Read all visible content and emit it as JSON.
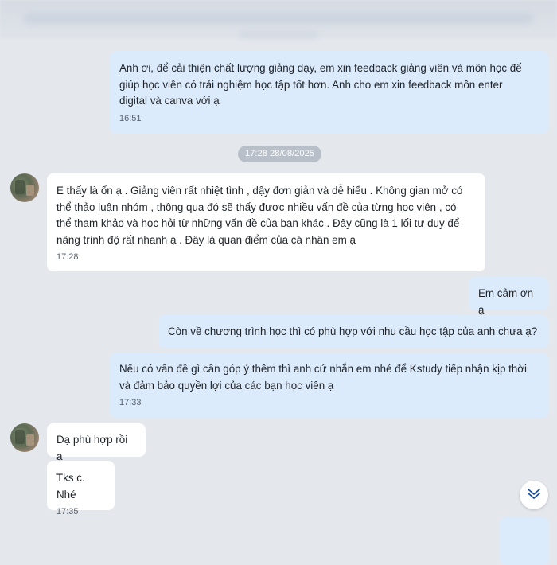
{
  "messages": {
    "m1": {
      "text": "Anh ơi, để cải thiện chất lượng giảng dạy, em xin feedback giảng viên và môn học để\ngiúp học viên có trải nghiệm học tập tốt hơn. Anh cho em xin feedback môn enter\ndigital và canva với ạ",
      "time": "16:51"
    },
    "date_separator": "17:28 28/08/2025",
    "m2": {
      "text": "E thấy là ổn ạ . Giảng viên rất nhiệt tình ,  dậy đơn giản và dễ hiểu . Không gian mở có\nthể thảo luận nhóm , thông qua đó sẽ thấy được nhiều vấn đề của từng học viên , có\nthể tham khảo và học hỏi từ những vấn đề của bạn khác . Đây cũng là 1 lối tư duy để\nnâng trình độ rất nhanh ạ . Đây là quan điểm của cá nhân em ạ",
      "time": "17:28"
    },
    "m3": {
      "text": "Em cảm ơn ạ"
    },
    "m4": {
      "text": "Còn về chương trình học thì có phù hợp với nhu cầu học tập của anh chưa ạ?"
    },
    "m5": {
      "text": "Nếu có vấn đề gì cần góp ý thêm thì anh cứ nhắn em nhé để Kstudy tiếp nhận kịp thời\nvà đảm bảo quyền lợi của các bạn học viên ạ",
      "time": "17:33"
    },
    "m6": {
      "text": "Dạ phù hợp rồi ạ"
    },
    "m7": {
      "text": "Tks c. Nhé",
      "time": "17:35"
    }
  },
  "icons": {
    "scroll_down": "double-chevron-down-icon"
  },
  "colors": {
    "outgoing_bubble": "#dbebfb",
    "incoming_bubble": "#ffffff",
    "background": "#e4e7ec"
  }
}
